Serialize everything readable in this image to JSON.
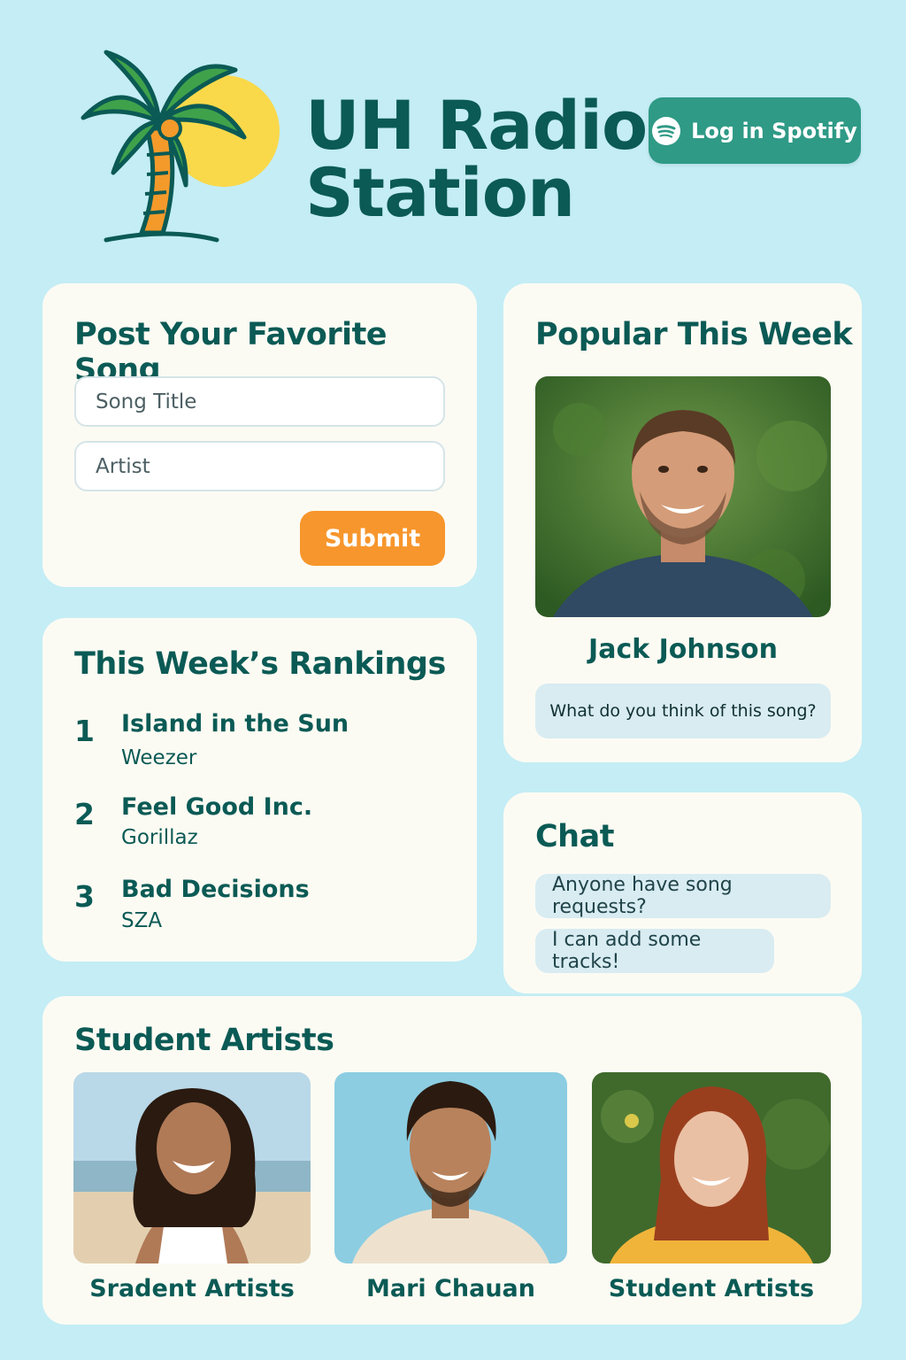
{
  "header": {
    "logo": "palm-tree-sun",
    "title_line1": "UH Radio",
    "title_line2": "Station",
    "spotify_button": {
      "label": "Log in Spotify",
      "icon": "spotify-icon"
    }
  },
  "post_song": {
    "title": "Post Your Favorite Song",
    "song_title_placeholder": "Song Title",
    "artist_placeholder": "Artist",
    "submit_label": "Submit"
  },
  "rankings": {
    "title": "This Week’s Rankings",
    "items": [
      {
        "rank": "1",
        "song": "Island in the Sun",
        "artist": "Weezer"
      },
      {
        "rank": "2",
        "song": "Feel Good Inc.",
        "artist": "Gorillaz"
      },
      {
        "rank": "3",
        "song": "Bad Decisions",
        "artist": "SZA"
      }
    ]
  },
  "popular": {
    "title": "Popular This Week",
    "artist_name": "Jack Johnson",
    "prompt": "What do you think of this song?"
  },
  "chat": {
    "title": "Chat",
    "messages": [
      "Anyone have song requests?",
      "I can add some tracks!"
    ]
  },
  "student_artists": {
    "title": "Student Artists",
    "artists": [
      {
        "name": "Sradent Artists"
      },
      {
        "name": "Mari Chauan"
      },
      {
        "name": "Student Artists"
      }
    ]
  },
  "colors": {
    "background": "#c4edf5",
    "brand": "#0b5a55",
    "spotify_button": "#2f9a86",
    "submit_button": "#f7962c",
    "card": "#fcfbf3"
  }
}
